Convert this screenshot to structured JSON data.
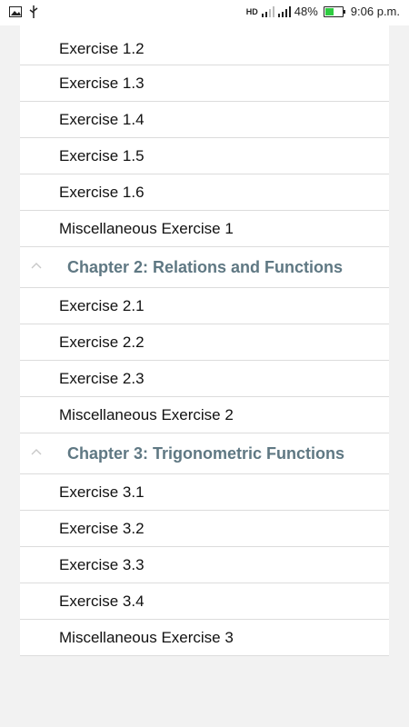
{
  "status_bar": {
    "battery_percent": "48%",
    "battery_level": 0.48,
    "time": "9:06 p.m.",
    "hd_label": "HD",
    "icons": [
      "image-icon",
      "usb-icon",
      "signal-icon",
      "battery-icon"
    ]
  },
  "list": {
    "group1_items": [
      "Exercise 1.2",
      "Exercise 1.3",
      "Exercise 1.4",
      "Exercise 1.5",
      "Exercise 1.6",
      "Miscellaneous Exercise 1"
    ],
    "chapter2": {
      "title": "Chapter 2: Relations and Functions",
      "items": [
        "Exercise 2.1",
        "Exercise 2.2",
        "Exercise 2.3",
        "Miscellaneous Exercise 2"
      ]
    },
    "chapter3": {
      "title": "Chapter 3: Trigonometric Functions",
      "items": [
        "Exercise 3.1",
        "Exercise 3.2",
        "Exercise 3.3",
        "Exercise 3.4",
        "Miscellaneous Exercise 3"
      ]
    }
  },
  "colors": {
    "chapter_title": "#5f7883",
    "divider": "#dcdcdc",
    "background": "#f2f2f2",
    "battery": "#2ecc40"
  }
}
